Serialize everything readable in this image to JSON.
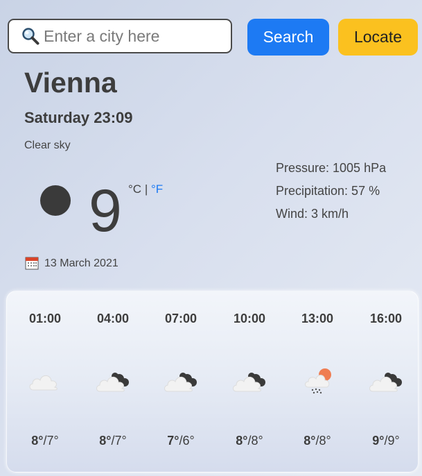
{
  "search": {
    "placeholder": "Enter a city here",
    "icon": "magnifying-glass-icon",
    "search_label": "Search",
    "locate_label": "Locate",
    "search_color": "#1d7af3",
    "locate_color": "#fbc11f"
  },
  "current": {
    "city": "Vienna",
    "datetime": "Saturday 23:09",
    "condition": "Clear sky",
    "icon": "moon-icon",
    "temperature": "9",
    "unit_c": "°C",
    "unit_sep": "|",
    "unit_f": "°F",
    "pressure": "Pressure: 1005 hPa",
    "precipitation": "Precipitation: 57 %",
    "wind": "Wind: 3 km/h",
    "date_icon": "calendar-icon",
    "date": "13 March 2021"
  },
  "forecast": [
    {
      "time": "01:00",
      "icon": "cloud-icon",
      "max": "8°",
      "min": "/7°"
    },
    {
      "time": "04:00",
      "icon": "cloud-night-icon",
      "max": "8°",
      "min": "/7°"
    },
    {
      "time": "07:00",
      "icon": "cloud-night-icon",
      "max": "7°",
      "min": "/6°"
    },
    {
      "time": "10:00",
      "icon": "cloud-night-icon",
      "max": "8°",
      "min": "/8°"
    },
    {
      "time": "13:00",
      "icon": "sun-rain-cloud-icon",
      "max": "8°",
      "min": "/8°"
    },
    {
      "time": "16:00",
      "icon": "cloud-night-icon",
      "max": "9°",
      "min": "/9°"
    }
  ]
}
